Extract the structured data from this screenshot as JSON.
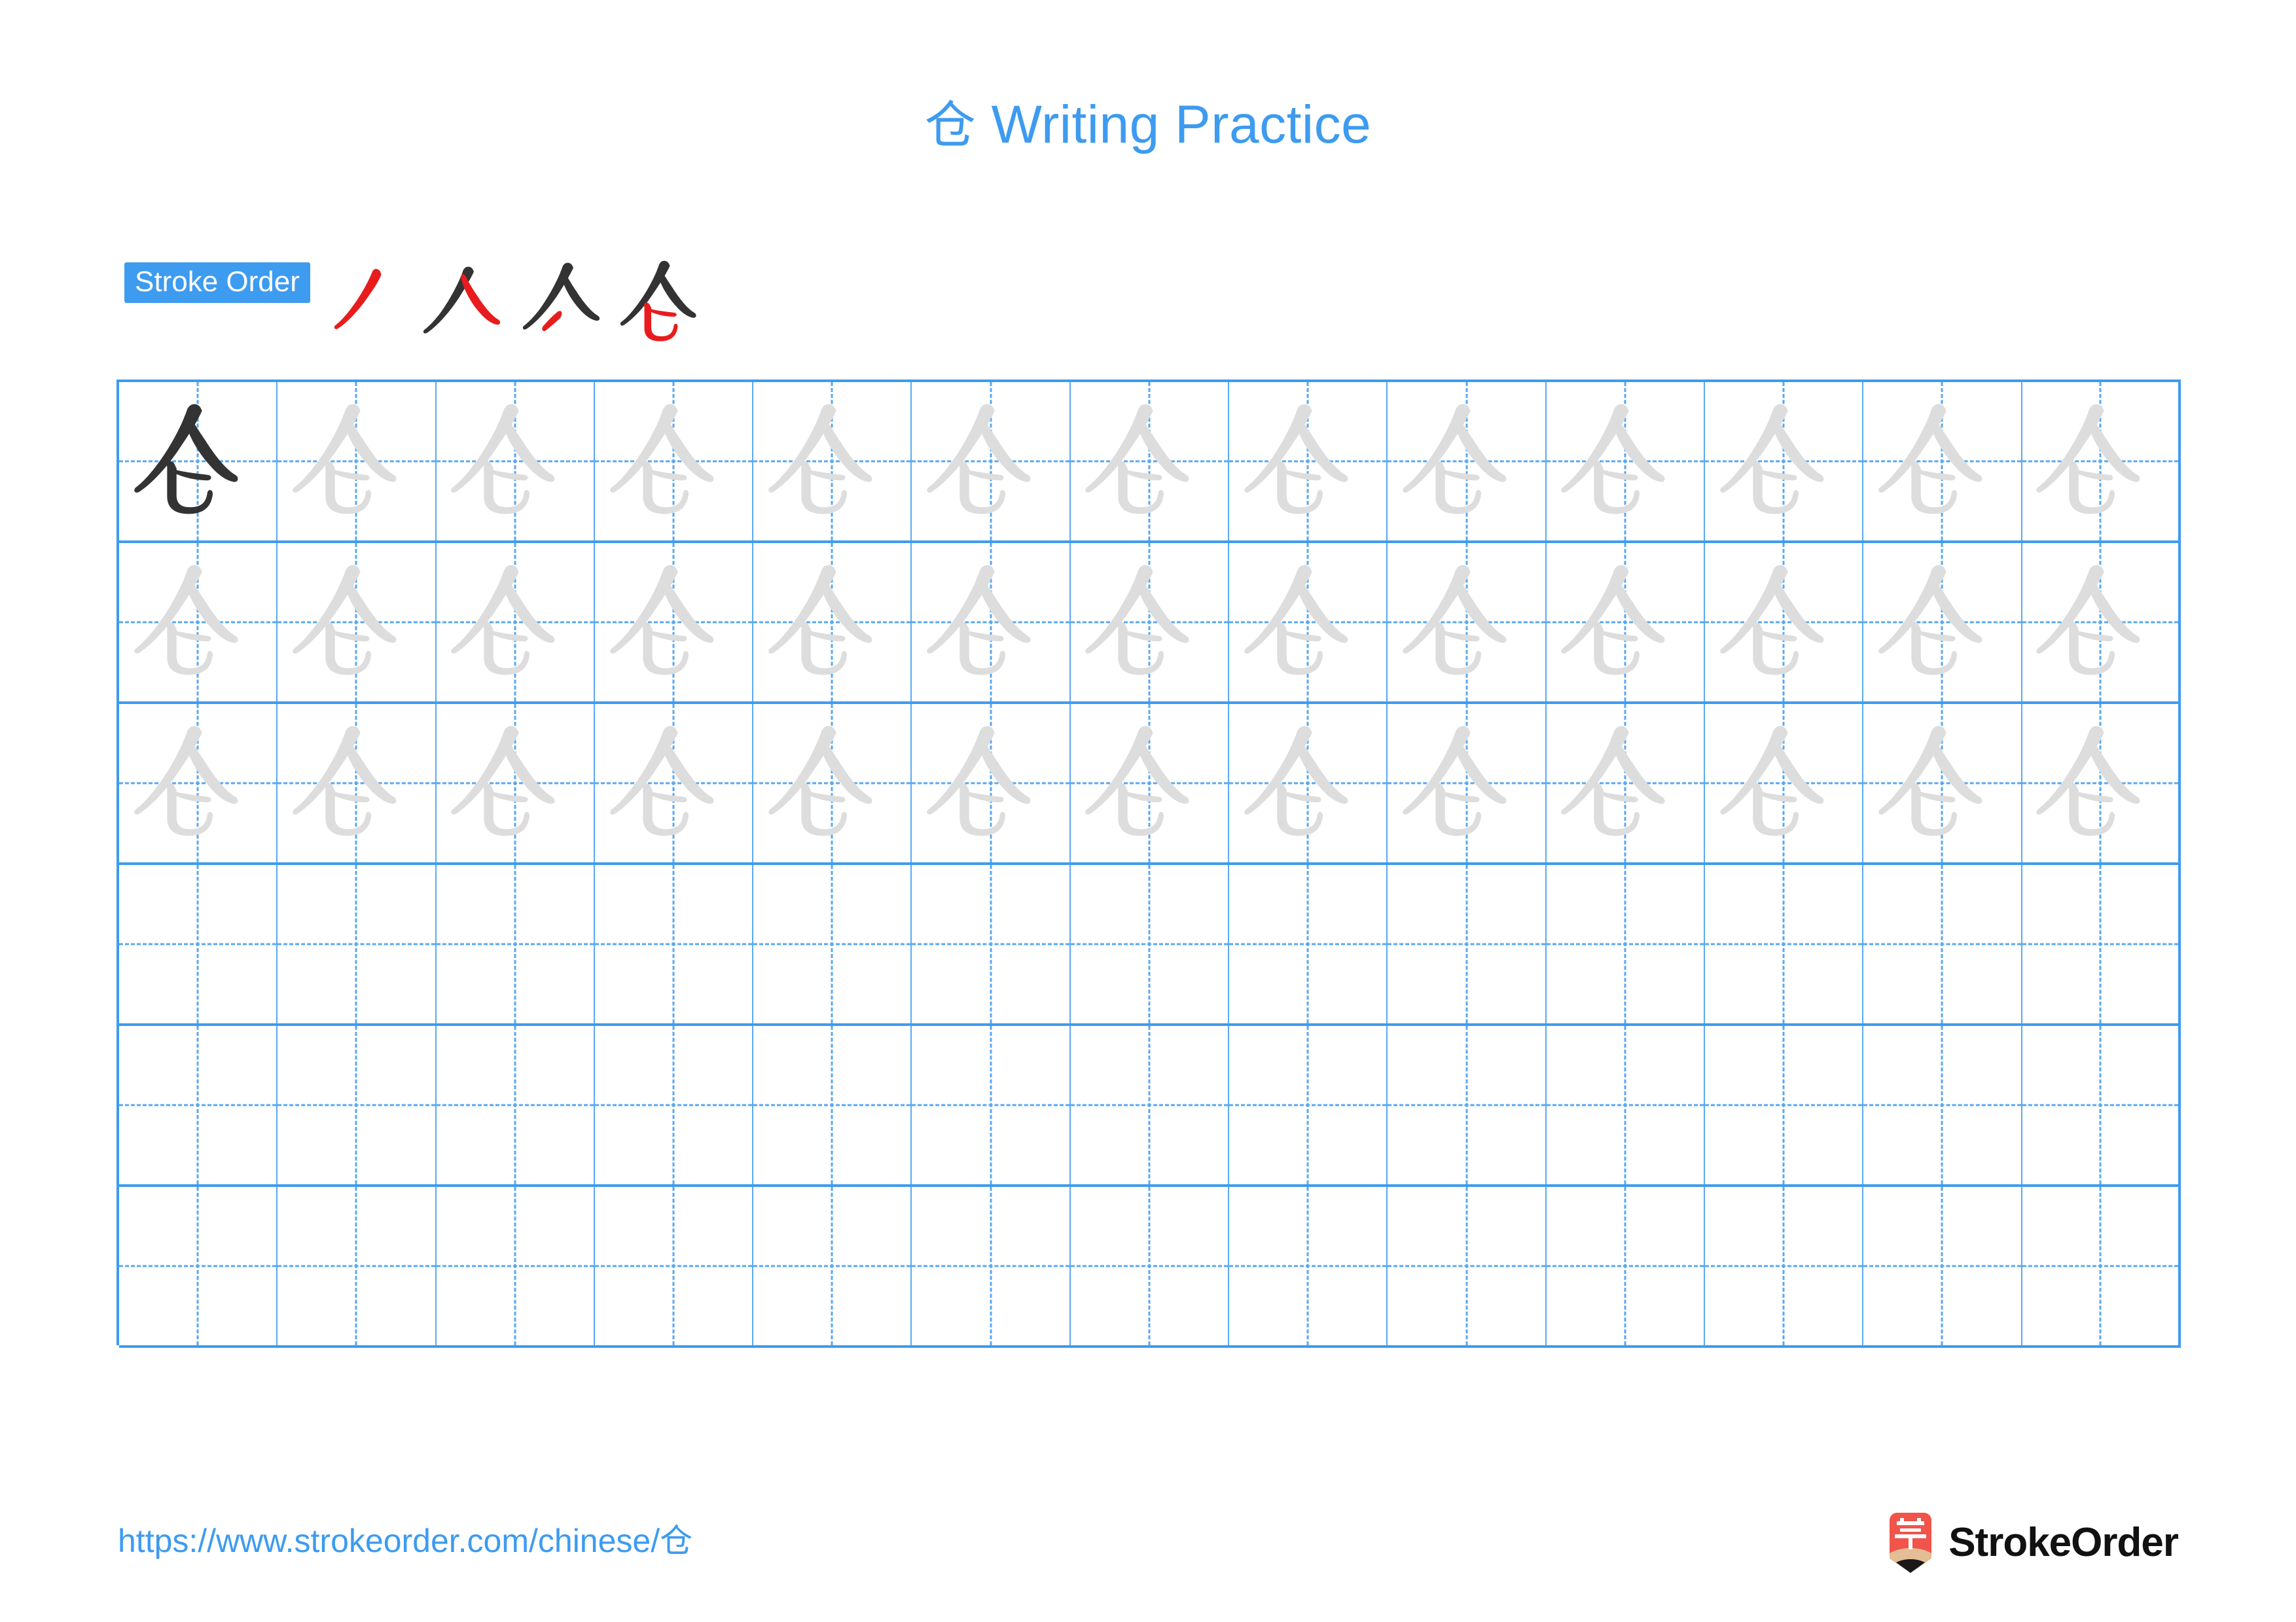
{
  "page": {
    "character": "仓",
    "title": "仓 Writing Practice",
    "title_prefix_char": "仓",
    "title_suffix": " Writing Practice",
    "background_color": "#ffffff"
  },
  "colors": {
    "accent_blue": "#3d9bf0",
    "grid_line_blue": "#3d9bf0",
    "grid_guide_blue": "#58a8f2",
    "trace_gray": "#dddddd",
    "model_dark": "#333333",
    "new_stroke_red": "#e81c1c",
    "logo_red": "#f1544a",
    "logo_wood": "#e2bd96",
    "logo_tip": "#1a1a1a"
  },
  "stroke_order": {
    "badge_label": "Stroke Order",
    "stroke_count": 4,
    "steps": [
      {
        "index": 1,
        "glyph": "丿",
        "new_stroke_color": "#e81c1c",
        "existing_stroke_color": "#333333"
      },
      {
        "index": 2,
        "glyph": "人",
        "new_stroke_color": "#e81c1c",
        "existing_stroke_color": "#333333"
      },
      {
        "index": 3,
        "glyph": "亽",
        "new_stroke_color": "#e81c1c",
        "existing_stroke_color": "#333333"
      },
      {
        "index": 4,
        "glyph": "仓",
        "new_stroke_color": "#e81c1c",
        "existing_stroke_color": "#333333"
      }
    ]
  },
  "grid": {
    "columns": 13,
    "rows": 6,
    "model_cell": {
      "row": 1,
      "column": 1,
      "character": "仓",
      "style": "dark"
    },
    "traced_rows": [
      1,
      2,
      3
    ],
    "blank_rows": [
      4,
      5,
      6
    ],
    "row_cells": [
      [
        "dark",
        "trace",
        "trace",
        "trace",
        "trace",
        "trace",
        "trace",
        "trace",
        "trace",
        "trace",
        "trace",
        "trace",
        "trace"
      ],
      [
        "trace",
        "trace",
        "trace",
        "trace",
        "trace",
        "trace",
        "trace",
        "trace",
        "trace",
        "trace",
        "trace",
        "trace",
        "trace"
      ],
      [
        "trace",
        "trace",
        "trace",
        "trace",
        "trace",
        "trace",
        "trace",
        "trace",
        "trace",
        "trace",
        "trace",
        "trace",
        "trace"
      ],
      [
        "blank",
        "blank",
        "blank",
        "blank",
        "blank",
        "blank",
        "blank",
        "blank",
        "blank",
        "blank",
        "blank",
        "blank",
        "blank"
      ],
      [
        "blank",
        "blank",
        "blank",
        "blank",
        "blank",
        "blank",
        "blank",
        "blank",
        "blank",
        "blank",
        "blank",
        "blank",
        "blank"
      ],
      [
        "blank",
        "blank",
        "blank",
        "blank",
        "blank",
        "blank",
        "blank",
        "blank",
        "blank",
        "blank",
        "blank",
        "blank",
        "blank"
      ]
    ]
  },
  "footer": {
    "url": "https://www.strokeorder.com/chinese/仓",
    "logo_text": "StrokeOrder",
    "logo_icon_char": "字"
  }
}
